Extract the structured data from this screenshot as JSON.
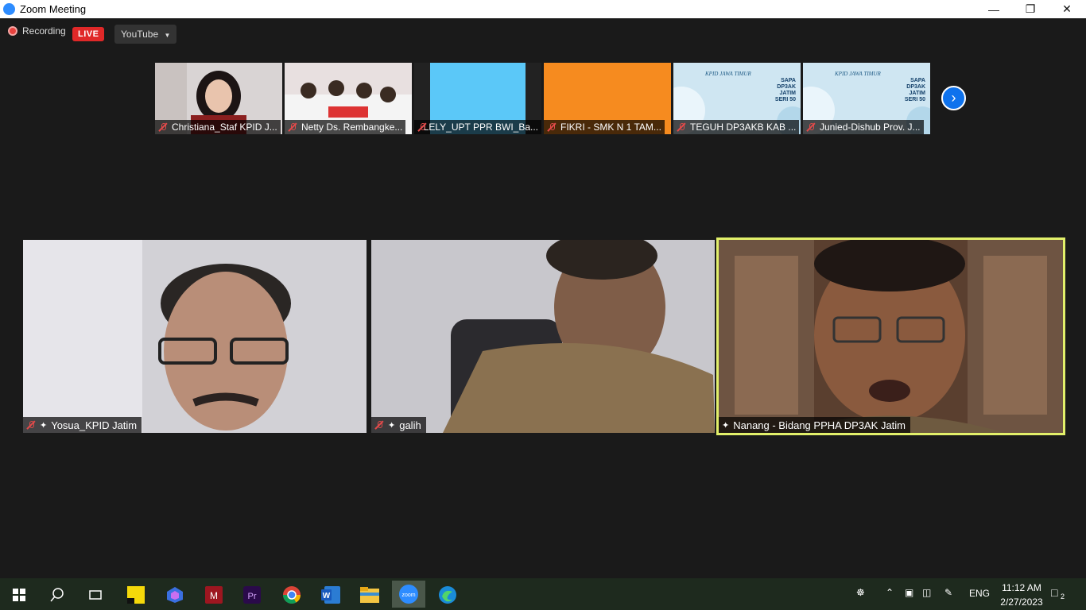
{
  "window": {
    "title": "Zoom Meeting"
  },
  "recording": {
    "label": "Recording",
    "live_badge": "LIVE",
    "stream_target": "YouTube"
  },
  "thumbnails": [
    {
      "name": "Christiana_Staf KPID J...",
      "bg": "#d9d4d4"
    },
    {
      "name": "Netty Ds. Rembangke...",
      "bg": "#e8e0e0"
    },
    {
      "name": "LELY_UPT PPR BWI_Ba...",
      "bg": "#5bc8f8"
    },
    {
      "name": "FIKRI - SMK N 1 TAM...",
      "bg": "#f68b1f"
    },
    {
      "name": "TEGUH DP3AKB KAB ...",
      "bg": "#cfe6f2",
      "slide": [
        "SAPA",
        "DP3AK",
        "JATIM",
        "SERI 50"
      ]
    },
    {
      "name": "Junied-Dishub Prov. J...",
      "bg": "#cfe6f2",
      "slide": [
        "SAPA",
        "DP3AK",
        "JATIM",
        "SERI 50"
      ]
    }
  ],
  "tiles": [
    {
      "name": "Yosua_KPID Jatim",
      "bg": "#cfcfd2"
    },
    {
      "name": "galih",
      "bg": "#b7b6bb"
    },
    {
      "name": "Nanang - Bidang PPHA DP3AK Jatim",
      "bg": "#6a4e3a",
      "active": true
    }
  ],
  "taskbar": {
    "language": "ENG",
    "time": "11:12 AM",
    "date": "2/27/2023",
    "notifications": "2",
    "apps": [
      "windows-start",
      "search",
      "task-view",
      "sticky-notes",
      "copilot",
      "mendeley",
      "premiere",
      "chrome",
      "word",
      "file-explorer",
      "zoom",
      "edge"
    ]
  },
  "colors": {
    "active_speaker": "#e2f06a",
    "zoom_blue": "#0e72ed",
    "live_red": "#e02828"
  }
}
